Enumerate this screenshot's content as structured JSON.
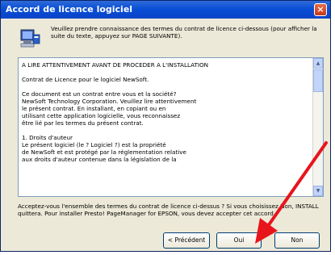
{
  "window": {
    "title": "Accord de licence logiciel",
    "close_symbol": "×"
  },
  "intro_text": "Veuillez prendre connaissance des termes du contrat de licence ci-dessous (pour afficher la suite du texte, appuyez sur PAGE SUIVANTE).",
  "license": {
    "paragraphs": [
      "A LIRE ATTENTIVEMENT AVANT DE PROCEDER A L'INSTALLATION",
      "Contrat de Licence pour le logiciel NewSoft.",
      "Ce document est un contrat entre vous et la société?\nNewSoft Technology Corporation. Veuillez lire attentivement\nle présent contrat. En installant, en copiant ou en\nutilisant cette application logicielle, vous reconnaissez\nêtre lié par les termes du présent contrat.",
      "1. Droits d'auteur\n   Le présent logiciel (le ? Logiciel ?) est la propriété\n   de NewSoft et est protégé par la réglementation relative\n   aux droits d'auteur contenue dans la législation de la"
    ]
  },
  "question_text": "Acceptez-vous l'ensemble des termes du contrat de licence ci-dessus ? Si vous choisissez Non, INSTALL quittera. Pour installer Presto! PageManager for EPSON, vous devez accepter cet accord.",
  "buttons": {
    "previous": "< Précédent",
    "yes": "Oui",
    "no": "Non"
  },
  "colors": {
    "titlebar": "#0a4fd6",
    "annotation_arrow": "#e8141c"
  },
  "icons": {
    "header": "setup-computer-icon",
    "close": "close-icon"
  }
}
